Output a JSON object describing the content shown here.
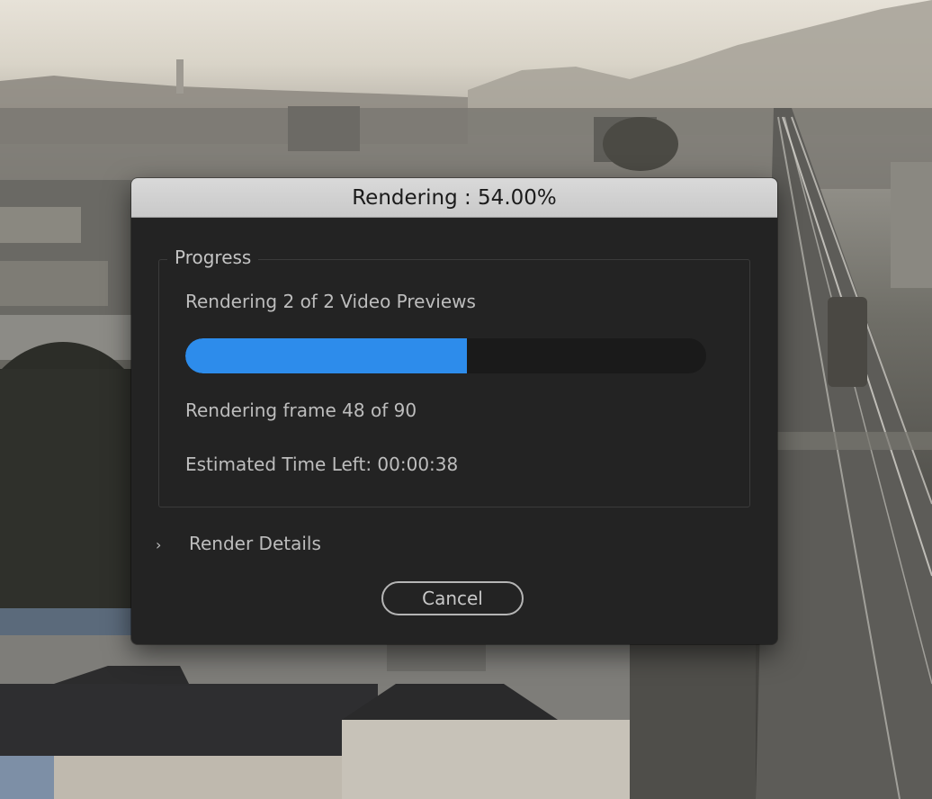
{
  "dialog": {
    "title": "Rendering : 54.00%",
    "progress_group_label": "Progress",
    "status": "Rendering 2 of 2 Video Previews",
    "progress_fraction": 0.54,
    "frame_status": "Rendering frame 48 of 90",
    "time_left": "Estimated Time Left: 00:00:38",
    "details_icon": "chevron-right-icon",
    "details_label": "Render Details",
    "cancel_label": "Cancel"
  },
  "colors": {
    "accent": "#2d8ceb",
    "dialog_bg": "#232323",
    "titlebar_bg": "#cfcfcf"
  }
}
